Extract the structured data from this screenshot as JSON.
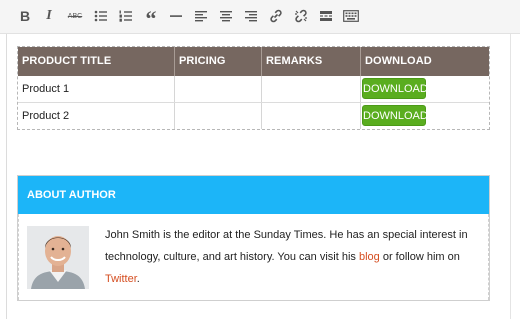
{
  "toolbar": {
    "buttons": [
      {
        "name": "bold-icon",
        "glyph": "B"
      },
      {
        "name": "italic-icon",
        "glyph": "I"
      },
      {
        "name": "strikethrough-icon",
        "glyph": "ABC"
      },
      {
        "name": "bulleted-list-icon"
      },
      {
        "name": "numbered-list-icon"
      },
      {
        "name": "blockquote-icon",
        "glyph": "“"
      },
      {
        "name": "horizontal-line-icon"
      },
      {
        "name": "align-left-icon"
      },
      {
        "name": "align-center-icon"
      },
      {
        "name": "align-right-icon"
      },
      {
        "name": "insert-link-icon"
      },
      {
        "name": "remove-link-icon"
      },
      {
        "name": "read-more-icon"
      },
      {
        "name": "toolbar-toggle-icon"
      }
    ]
  },
  "product_table": {
    "headers": [
      "PRODUCT TITLE",
      "PRICING",
      "REMARKS",
      "DOWNLOAD"
    ],
    "rows": [
      {
        "title": "Product 1",
        "pricing": "",
        "remarks": "",
        "download_label": "DOWNLOAD"
      },
      {
        "title": "Product 2",
        "pricing": "",
        "remarks": "",
        "download_label": "DOWNLOAD"
      }
    ],
    "header_color": "#766760",
    "button_color": "#5aad1f"
  },
  "author_box": {
    "title": "ABOUT AUTHOR",
    "header_color": "#1cb5f8",
    "bio_before_blog": "John Smith is the editor at the Sunday Times. He has an special interest in technology, culture, and art history. You can visit his ",
    "blog_link": "blog",
    "bio_middle": " or follow him on ",
    "twitter_link": "Twitter",
    "bio_end": ".",
    "link_color": "#d54e21",
    "photo_icon": "author-photo"
  }
}
